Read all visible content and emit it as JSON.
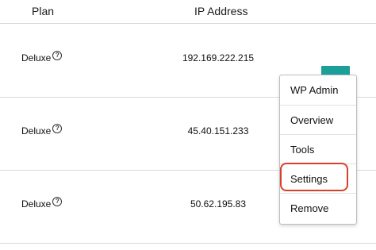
{
  "table": {
    "columns": {
      "plan": "Plan",
      "ip": "IP Address"
    },
    "rows": [
      {
        "plan": "Deluxe",
        "help": "?",
        "ip": "192.169.222.215"
      },
      {
        "plan": "Deluxe",
        "help": "?",
        "ip": "45.40.151.233"
      },
      {
        "plan": "Deluxe",
        "help": "?",
        "ip": "50.62.195.83"
      }
    ]
  },
  "actions": {
    "kebab_label": "⋯",
    "menu": [
      "WP Admin",
      "Overview",
      "Tools",
      "Settings",
      "Remove"
    ],
    "highlighted_item": "Settings"
  },
  "colors": {
    "accent": "#1c9f98",
    "highlight": "#d9402b"
  }
}
